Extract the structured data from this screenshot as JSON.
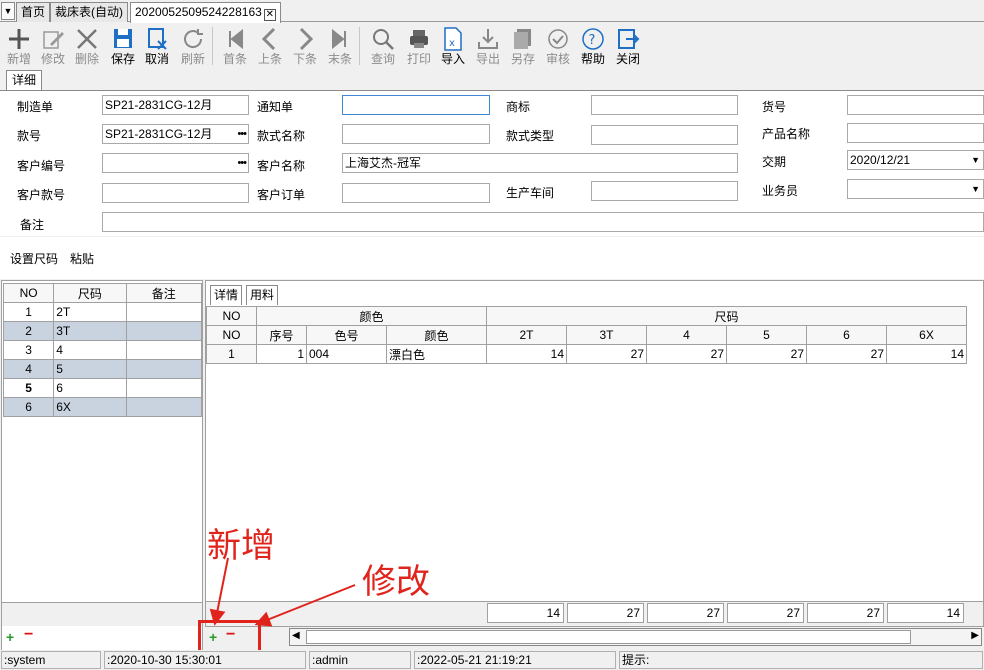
{
  "tabs": {
    "home": "首页",
    "cutting_table": "裁床表(自动)",
    "order": "2020052509524228163"
  },
  "toolbar": {
    "new": "新增",
    "edit": "修改",
    "delete": "删除",
    "save": "保存",
    "cancel": "取消",
    "refresh": "刷新",
    "first": "首条",
    "prev": "上条",
    "next": "下条",
    "last": "末条",
    "query": "查询",
    "print": "打印",
    "import": "导入",
    "export": "导出",
    "save_as": "另存",
    "review": "审核",
    "help": "帮助",
    "close": "关闭"
  },
  "detail_tab": "详细",
  "form": {
    "manufacture_order_label": "制造单",
    "manufacture_order_value": "SP21-2831CG-12月",
    "notice_label": "通知单",
    "notice_value": "",
    "brand_label": "商标",
    "brand_value": "",
    "item_no_label": "货号",
    "item_no_value": "",
    "style_no_label": "款号",
    "style_no_value": "SP21-2831CG-12月",
    "style_name_label": "款式名称",
    "style_name_value": "",
    "style_type_label": "款式类型",
    "style_type_value": "",
    "product_name_label": "产品名称",
    "product_name_value": "",
    "customer_code_label": "客户编号",
    "customer_code_value": "",
    "customer_name_label": "客户名称",
    "customer_name_value": "上海艾杰-冠军",
    "delivery_label": "交期",
    "delivery_value": "2020/12/21",
    "customer_style_label": "客户款号",
    "customer_style_value": "",
    "customer_order_label": "客户订单",
    "customer_order_value": "",
    "workshop_label": "生产车间",
    "workshop_value": "",
    "salesman_label": "业务员",
    "salesman_value": "",
    "remark_label": "备注",
    "remark_value": ""
  },
  "actions": {
    "set_size": "设置尺码",
    "paste": "粘贴"
  },
  "size_grid": {
    "headers": [
      "NO",
      "尺码",
      "备注"
    ],
    "rows": [
      {
        "no": "1",
        "size": "2T",
        "note": ""
      },
      {
        "no": "2",
        "size": "3T",
        "note": ""
      },
      {
        "no": "3",
        "size": "4",
        "note": ""
      },
      {
        "no": "4",
        "size": "5",
        "note": ""
      },
      {
        "no": "5",
        "size": "6",
        "note": ""
      },
      {
        "no": "6",
        "size": "6X",
        "note": ""
      }
    ]
  },
  "subtabs": {
    "detail": "详情",
    "material": "用料"
  },
  "detail_grid": {
    "group_color": "颜色",
    "group_size": "尺码",
    "col_no": "NO",
    "col_seq": "序号",
    "col_color_code": "色号",
    "col_color": "颜色",
    "size_cols": [
      "2T",
      "3T",
      "4",
      "5",
      "6",
      "6X"
    ],
    "rows": [
      {
        "no": "1",
        "seq": "1",
        "color_code": "004",
        "color": "漂白色",
        "qty": [
          "14",
          "27",
          "27",
          "27",
          "27",
          "14"
        ]
      }
    ],
    "totals": [
      "14",
      "27",
      "27",
      "27",
      "27",
      "14"
    ]
  },
  "statusbar": {
    "system": ":system",
    "created": ":2020-10-30 15:30:01",
    "user": ":admin",
    "modified": ":2022-05-21 21:19:21",
    "hint": "提示:"
  },
  "annotations": {
    "add": "新增",
    "edit": "修改"
  },
  "colors": {
    "annotation": "#e0241c",
    "selected_row": "#c9d3df",
    "toolbar_icon": "#1f6fc5"
  }
}
